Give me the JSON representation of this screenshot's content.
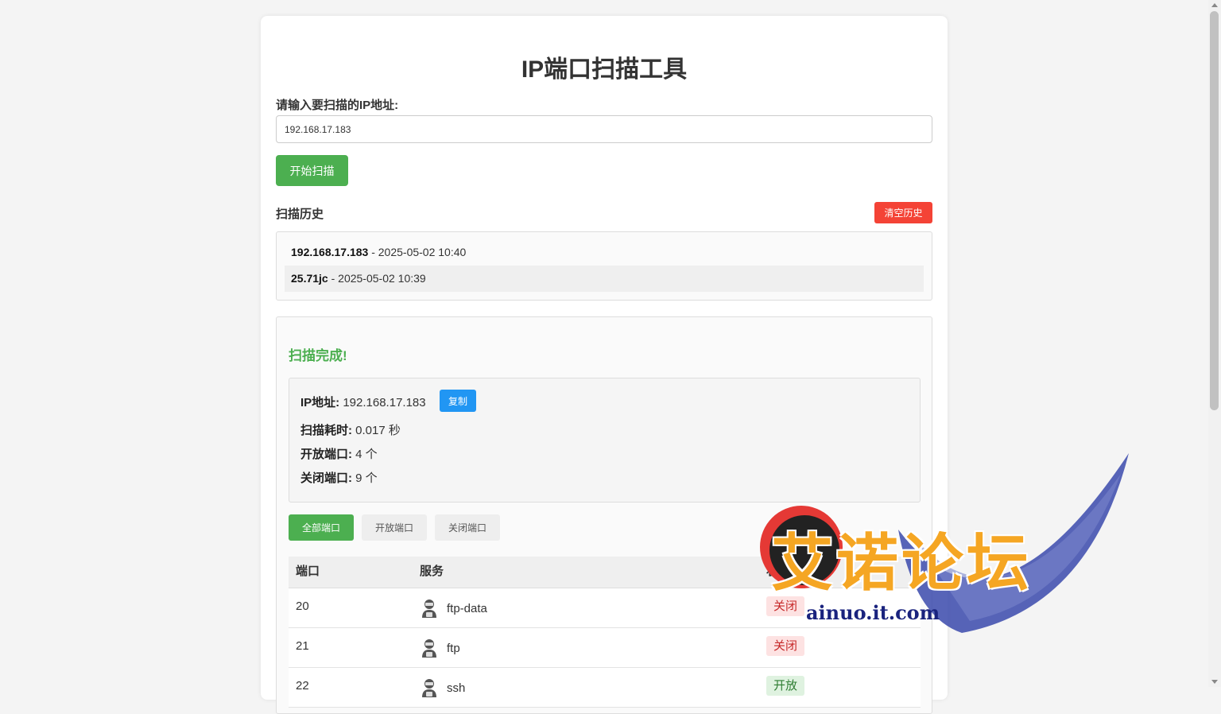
{
  "app": {
    "title": "IP端口扫描工具"
  },
  "form": {
    "ip_label": "请输入要扫描的IP地址:",
    "ip_value": "192.168.17.183",
    "scan_button": "开始扫描"
  },
  "history": {
    "title": "扫描历史",
    "clear_button": "清空历史",
    "items": [
      {
        "target": "192.168.17.183",
        "time": " - 2025-05-02 10:40"
      },
      {
        "target": "25.71jc",
        "time": " - 2025-05-02 10:39"
      }
    ]
  },
  "result": {
    "status": "扫描完成!",
    "ip_label": "IP地址:",
    "ip_value": " 192.168.17.183",
    "copy_button": "复制",
    "duration_label": "扫描耗时:",
    "duration_value": " 0.017 秒",
    "open_label": "开放端口:",
    "open_value": " 4 个",
    "closed_label": "关闭端口:",
    "closed_value": " 9 个"
  },
  "filters": {
    "all": "全部端口",
    "open": "开放端口",
    "closed": "关闭端口"
  },
  "table": {
    "headers": {
      "port": "端口",
      "service": "服务",
      "state": "状态"
    },
    "rows": [
      {
        "port": "20",
        "service": "ftp-data",
        "state": "关闭",
        "state_type": "closed"
      },
      {
        "port": "21",
        "service": "ftp",
        "state": "关闭",
        "state_type": "closed"
      },
      {
        "port": "22",
        "service": "ssh",
        "state": "开放",
        "state_type": "open"
      }
    ]
  },
  "watermark": {
    "text": "艾诺论坛",
    "url": "ainuo.it.com"
  },
  "colors": {
    "primary_green": "#4caf50",
    "danger_red": "#f44336",
    "info_blue": "#2196f3"
  }
}
